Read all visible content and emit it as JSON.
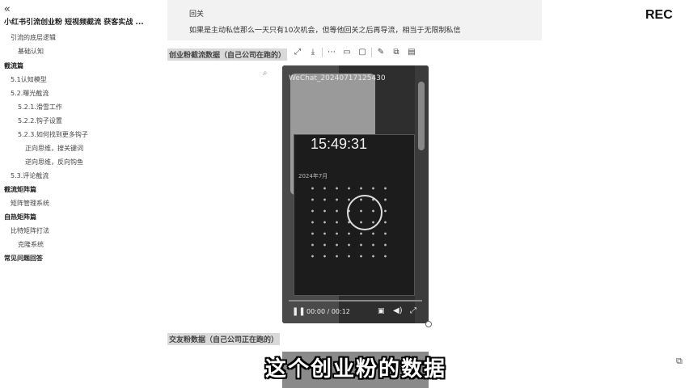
{
  "sidebar": {
    "collapse_icon": "double-chevron-left-icon",
    "doc_title": "小红书引流创业粉 短视频截流 获客实战 ...",
    "items": [
      {
        "label": "引流的底层逻辑",
        "level": 2
      },
      {
        "label": "基础认知",
        "level": 3
      },
      {
        "label": "截流篇",
        "level": 1
      },
      {
        "label": "5.1认知模型",
        "level": 2
      },
      {
        "label": "5.2.曝光截流",
        "level": 2
      },
      {
        "label": "5.2.1.滑雪工作",
        "level": 3
      },
      {
        "label": "5.2.2.钩子设置",
        "level": 3
      },
      {
        "label": "5.2.3.如何找到更多钩子",
        "level": 3
      },
      {
        "label": "正向思维，搜关键词",
        "level": 4
      },
      {
        "label": "逆向思维，反向钩鱼",
        "level": 4
      },
      {
        "label": "5.3.评论截流",
        "level": 2
      },
      {
        "label": "截流矩阵篇",
        "level": 1
      },
      {
        "label": "矩阵管理系统",
        "level": 2
      },
      {
        "label": "自热矩阵篇",
        "level": 1
      },
      {
        "label": "比特矩阵打法",
        "level": 2
      },
      {
        "label": "克隆系统",
        "level": 3
      },
      {
        "label": "常见问题回答",
        "level": 1
      }
    ]
  },
  "main": {
    "note_line1": "回关",
    "note_line2": "如果是主动私信那么一天只有10次机会，但等他回关之后再导流，相当于无限制私信",
    "heading1": "创业粉截流数据（自己公司在跑的）",
    "heading2": "交友粉数据（自己公司正在跑的）",
    "toolbar_icons": [
      "expand-icon",
      "download-icon",
      "more-icon",
      "card-view-icon",
      "preview-icon",
      "edit-icon",
      "comment-icon",
      "link-icon"
    ],
    "attach_icon": "paperclip-icon"
  },
  "video": {
    "overlay_text": "WeChat_20240717125430",
    "clock": "15:49:31",
    "year_label": "2024年7月",
    "current_time": "00:00",
    "duration": "00:12",
    "time_display": "00:00 / 00:12",
    "progress": 0.0,
    "play_icon": "pause-icon",
    "pip_icon": "picture-in-picture-icon",
    "volume_icon": "volume-icon",
    "fullscreen_icon": "fullscreen-icon"
  },
  "overlay": {
    "rec_label": "REC",
    "subtitle": "这个创业粉的数据"
  },
  "colors": {
    "highlight": "#d9d9d9",
    "note_bg": "#f2f2f2",
    "video_bg": "#2e2e2e"
  }
}
